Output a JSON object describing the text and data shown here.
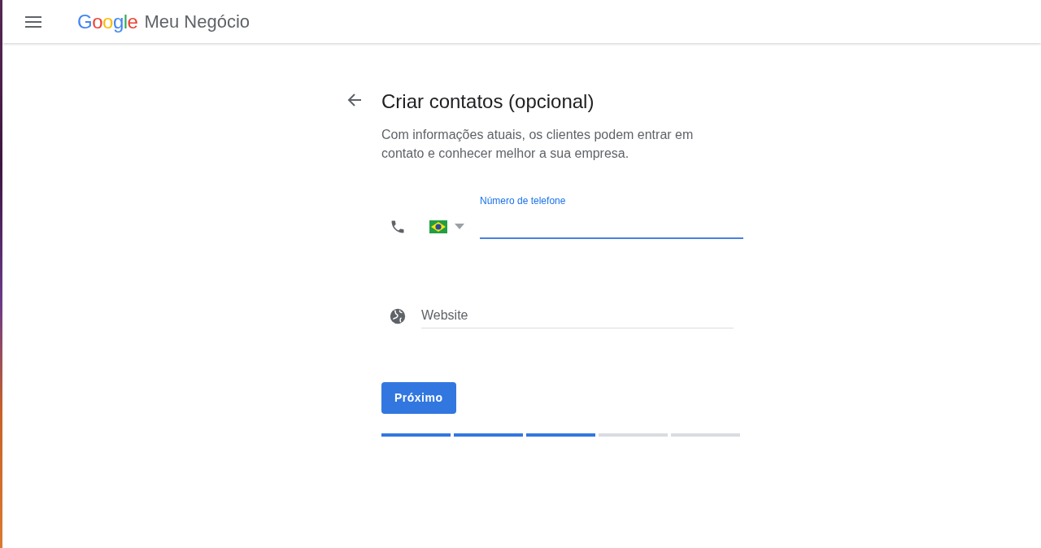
{
  "header": {
    "logo": "Google",
    "product": "Meu Negócio"
  },
  "form": {
    "title": "Criar contatos (opcional)",
    "description": "Com informações atuais, os clientes podem entrar em contato e conhecer melhor a sua empresa.",
    "phone": {
      "label": "Número de telefone",
      "focused": true
    },
    "website": {
      "placeholder": "Website"
    },
    "button": "Próximo",
    "steps": [
      {
        "done": true
      },
      {
        "done": true
      },
      {
        "done": true
      },
      {
        "done": false
      },
      {
        "done": false
      }
    ]
  }
}
